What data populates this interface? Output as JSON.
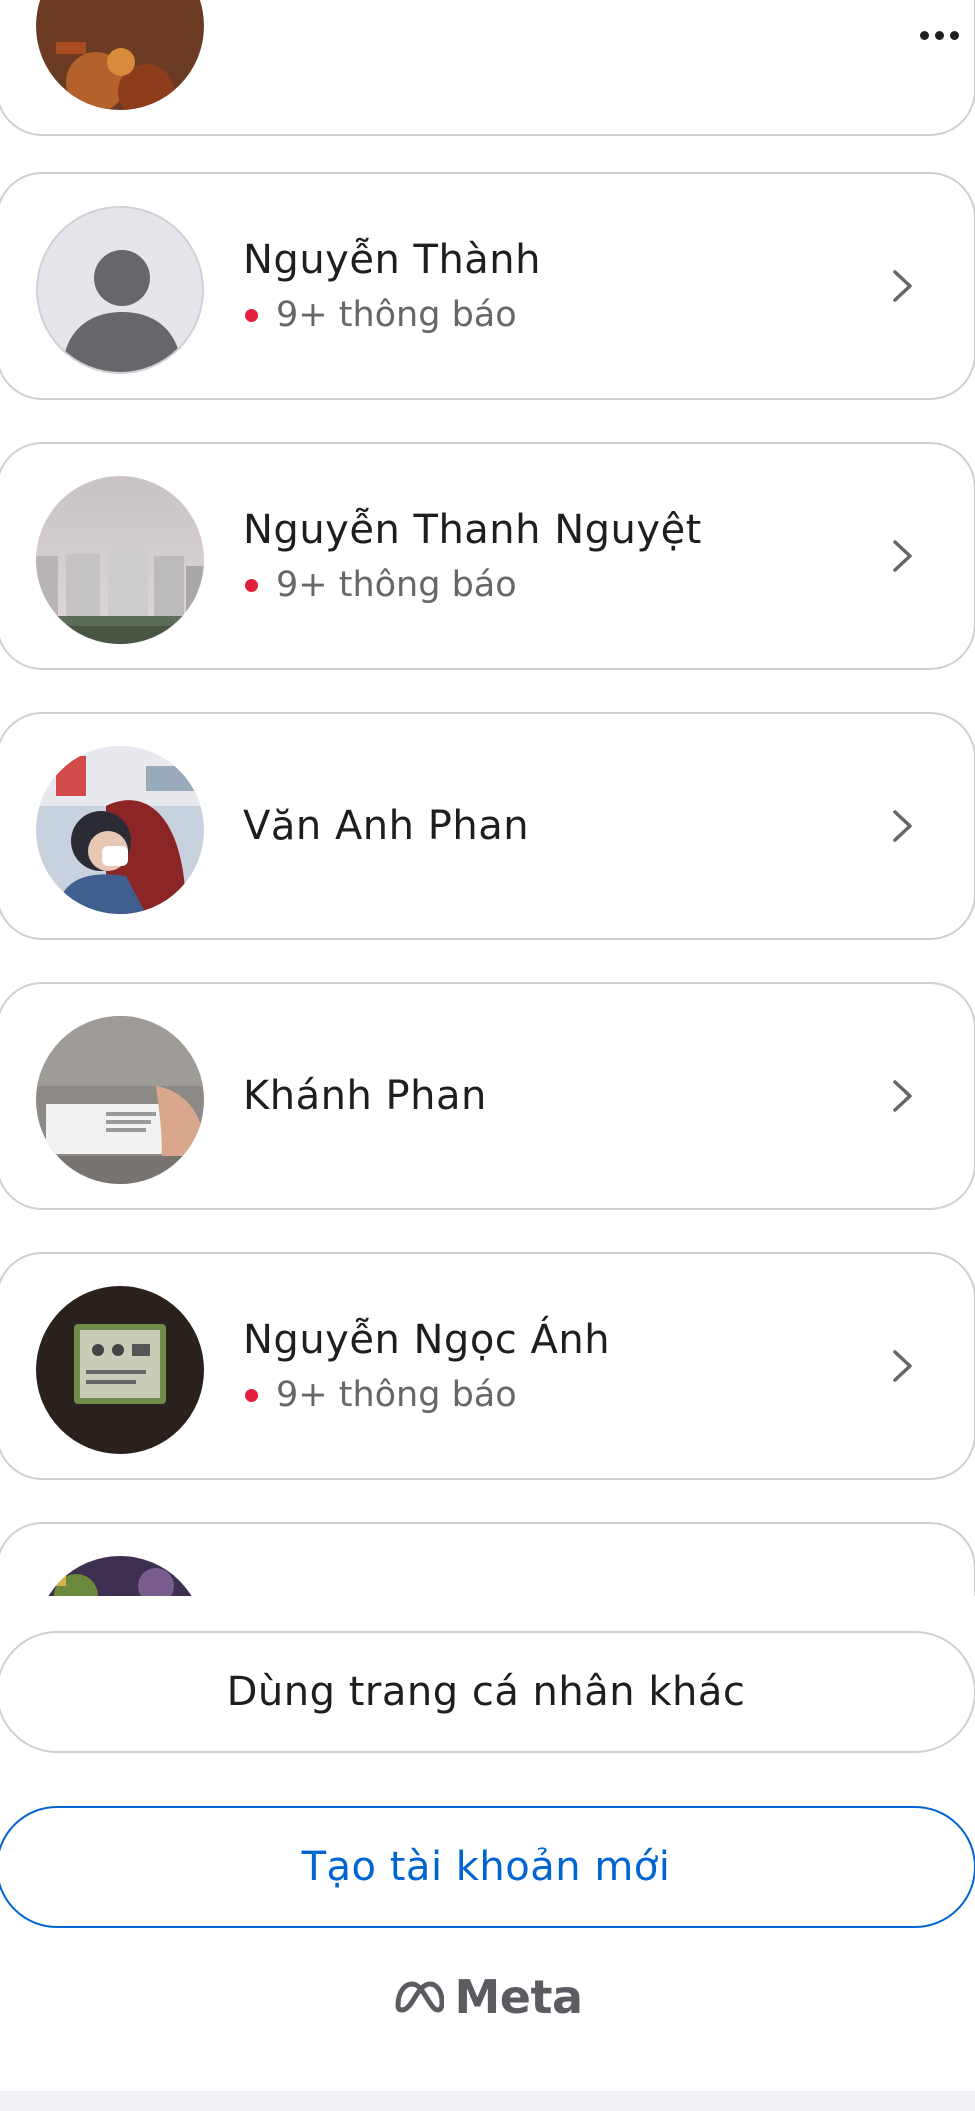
{
  "accounts": [
    {
      "name": "",
      "notifications": ""
    },
    {
      "name": "Nguyễn Thành",
      "notifications": "9+ thông báo"
    },
    {
      "name": "Nguyễn Thanh Nguyệt",
      "notifications": "9+ thông báo"
    },
    {
      "name": "Văn Anh Phan",
      "notifications": ""
    },
    {
      "name": "Khánh Phan",
      "notifications": ""
    },
    {
      "name": "Nguyễn Ngọc Ánh",
      "notifications": "9+ thông báo"
    },
    {
      "name": "",
      "notifications": ""
    }
  ],
  "buttons": {
    "use_other_profile": "Dùng trang cá nhân khác",
    "create_account": "Tạo tài khoản mới"
  },
  "footer": {
    "brand": "Meta"
  },
  "colors": {
    "accent": "#0064d1",
    "notification_dot": "#e41e3f",
    "border": "#ced0d4",
    "secondary_text": "#65676b",
    "primary_text": "#1c1e21"
  },
  "icons": {
    "more": "more-horizontal-icon",
    "chevron": "chevron-right-icon",
    "brand": "meta-logo-icon"
  }
}
